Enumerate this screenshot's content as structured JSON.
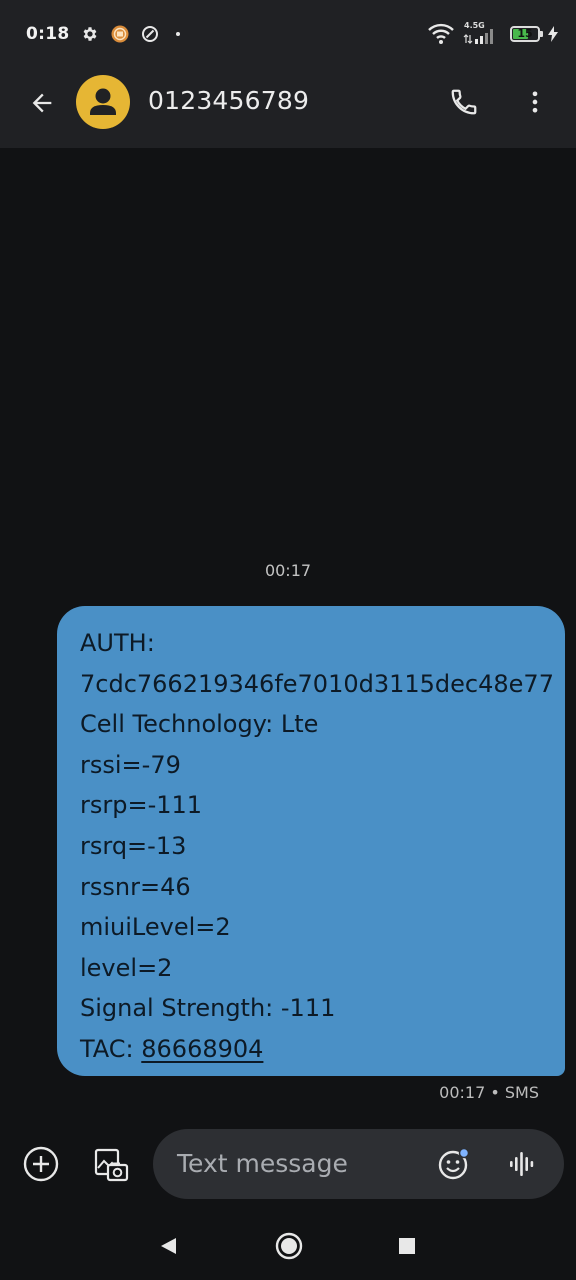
{
  "status_bar": {
    "time": "0:18",
    "left_icons": [
      "gear-icon",
      "app-badge-icon",
      "data-saver-icon",
      "dot-icon"
    ],
    "network_type": "4.5G",
    "battery_level": "15",
    "battery_fraction": 0.15,
    "charging": true,
    "colors": {
      "battery": "#49b84c",
      "background": "#202124"
    }
  },
  "header": {
    "contact": "0123456789",
    "icons": [
      "back-arrow-icon",
      "person-avatar-icon",
      "phone-icon",
      "more-vert-icon"
    ],
    "colors": {
      "avatar": "#e6b634"
    }
  },
  "conversation": {
    "date_divider": "00:17",
    "message": {
      "lines": [
        "AUTH:",
        "7cdc766219346fe7010d3115dec48e77",
        "Cell Technology: Lte",
        "rssi=-79",
        "rsrp=-111",
        "rsrq=-13",
        "rssnr=46",
        "miuiLevel=2",
        "level=2",
        "Signal Strength: -111"
      ],
      "tac_label": "TAC: ",
      "tac_value": "86668904",
      "meta": "00:17 • SMS",
      "bubble_color": "#4a90c6"
    }
  },
  "compose": {
    "placeholder": "Text message",
    "icons": [
      "add-circle-icon",
      "gallery-icon",
      "emoji-icon",
      "voice-icon"
    ]
  },
  "nav_bar": {
    "icons": [
      "nav-back-icon",
      "nav-home-icon",
      "nav-recents-icon"
    ]
  }
}
